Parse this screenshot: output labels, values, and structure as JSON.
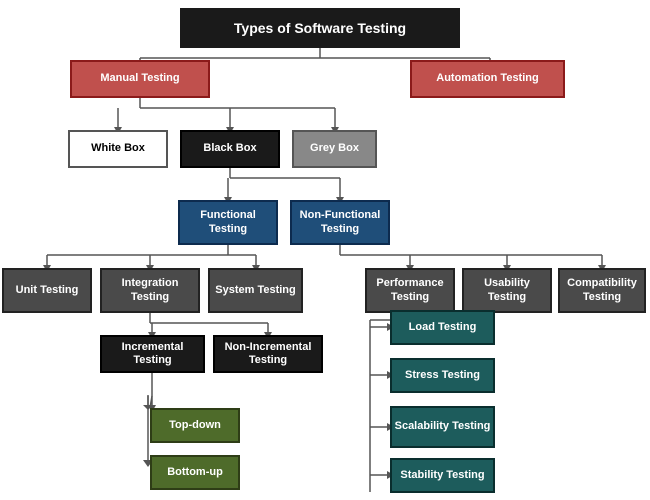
{
  "title": "Types of Software Testing",
  "boxes": {
    "title": "Types of Software Testing",
    "manual": "Manual Testing",
    "automation": "Automation Testing",
    "whitebox": "White Box",
    "blackbox": "Black Box",
    "greybox": "Grey Box",
    "functional": "Functional Testing",
    "nonfunctional": "Non-Functional Testing",
    "unit": "Unit Testing",
    "integration": "Integration Testing",
    "system": "System Testing",
    "performance": "Performance Testing",
    "usability": "Usability Testing",
    "compatibility": "Compatibility Testing",
    "incremental": "Incremental Testing",
    "nonincremental": "Non-Incremental Testing",
    "topdown": "Top-down",
    "bottomup": "Bottom-up",
    "load": "Load Testing",
    "stress": "Stress Testing",
    "scalability": "Scalability Testing",
    "stability": "Stability Testing"
  }
}
